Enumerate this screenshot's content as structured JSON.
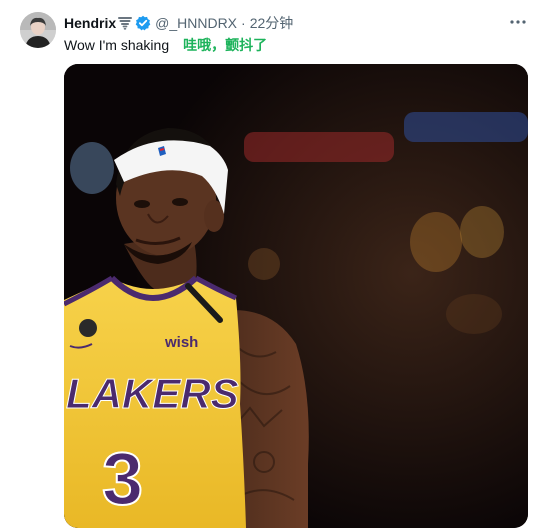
{
  "tweet": {
    "author": {
      "display_name": "Hendrix",
      "handle": "@_HNNDRX",
      "name_emoji": "tornado-icon",
      "verified": true
    },
    "separator": "·",
    "timestamp": "22分钟",
    "text": "Wow I'm shaking",
    "translation": "哇哦，颤抖了",
    "media": {
      "jersey_team": "LAKERS",
      "jersey_number": "3",
      "jersey_sponsor": "wish"
    }
  },
  "colors": {
    "verified": "#1d9bf0",
    "translation": "#1db35b",
    "jersey_yellow": "#f2c531",
    "jersey_purple": "#4b2a6e"
  }
}
